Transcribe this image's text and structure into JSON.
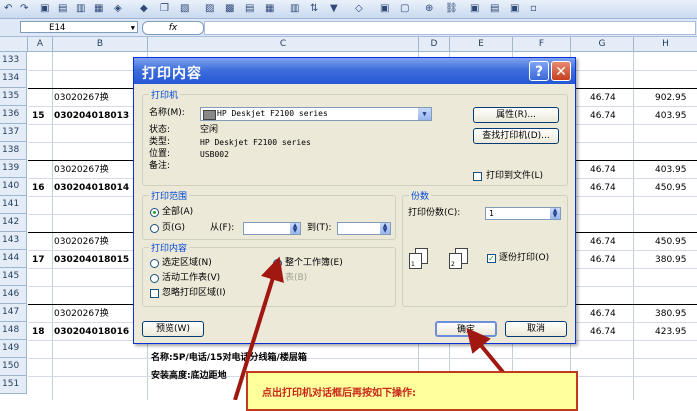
{
  "toolbar": {
    "quick_access_suffix": "▫"
  },
  "formula_bar": {
    "cell_ref": "E14",
    "fx_label": "fx"
  },
  "columns": [
    "A",
    "B",
    "C",
    "D",
    "E",
    "F",
    "G",
    "H"
  ],
  "rows": [
    {
      "num": "133"
    },
    {
      "num": "134"
    },
    {
      "num": "135"
    },
    {
      "num": "136"
    },
    {
      "num": "137"
    },
    {
      "num": "138"
    },
    {
      "num": "139"
    },
    {
      "num": "140"
    },
    {
      "num": "141"
    },
    {
      "num": "142"
    },
    {
      "num": "143"
    },
    {
      "num": "144"
    },
    {
      "num": "145"
    },
    {
      "num": "146"
    },
    {
      "num": "147"
    },
    {
      "num": "148"
    },
    {
      "num": "149"
    },
    {
      "num": "150"
    },
    {
      "num": "151"
    }
  ],
  "sheet": {
    "code_135": "03020267换",
    "idx_136": "15",
    "code_136": "030204018013",
    "code_139": "03020267换",
    "idx_140": "16",
    "code_140": "030204018014",
    "code_143": "03020267换",
    "idx_144": "17",
    "code_144": "030204018015",
    "code_147": "03020267换",
    "idx_148": "18",
    "code_148": "030204018016",
    "g_135": "46.74",
    "h_135": "902.95",
    "g_136": "46.74",
    "h_136": "403.95",
    "g_139": "46.74",
    "h_139": "403.95",
    "g_140": "46.74",
    "h_140": "450.95",
    "g_143": "46.74",
    "h_143": "450.95",
    "g_144": "46.74",
    "h_144": "380.95",
    "g_147": "46.74",
    "h_147": "380.95",
    "g_148": "46.74",
    "h_148": "423.95",
    "c_149": "名称:5P/电话/15对电话分线箱/楼层箱",
    "c_150": "安装高度:底边距地"
  },
  "dialog": {
    "title": "打印内容",
    "help_label": "?",
    "close_label": "✕",
    "printer_group": "打印机",
    "name_label": "名称(M):",
    "printer_name": "HP Deskjet F2100 series",
    "status_label": "状态:",
    "status_value": "空闲",
    "type_label": "类型:",
    "type_value": "HP Deskjet F2100 series",
    "location_label": "位置:",
    "location_value": "USB002",
    "comment_label": "备注:",
    "properties_button": "属性(R)...",
    "find_printer_button": "查找打印机(D)...",
    "print_to_file_label": "打印到文件(L)",
    "range_group": "打印范围",
    "all_label": "全部(A)",
    "pages_label": "页(G)",
    "from_label": "从(F):",
    "to_label": "到(T):",
    "copies_group": "份数",
    "copies_label": "打印份数(C):",
    "copies_value": "1",
    "collate_label": "逐份打印(O)",
    "content_group": "打印内容",
    "selection_label": "选定区域(N)",
    "active_sheet_label": "活动工作表(V)",
    "ignore_area_label": "忽略打印区域(I)",
    "workbook_label": "整个工作簿(E)",
    "table_label": "表(B)",
    "preview_button": "预览(W)",
    "ok_button": "确定",
    "cancel_button": "取消"
  },
  "annotation": {
    "text": "点出打印机对话框后再按如下操作:"
  },
  "colors": {
    "arrow": "#a01810",
    "accent": "#2457d4"
  }
}
